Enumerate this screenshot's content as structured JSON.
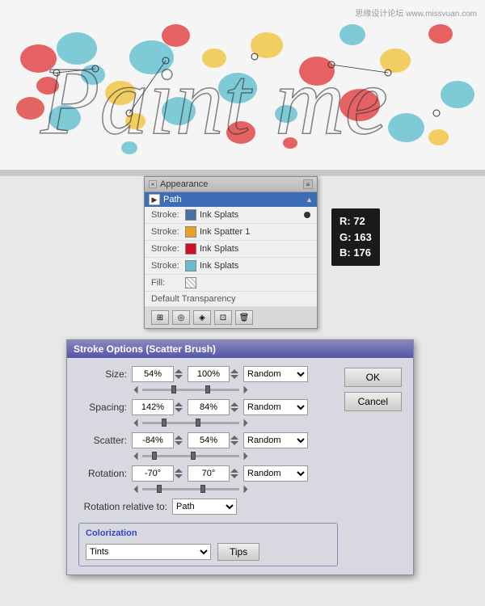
{
  "watermark": "思缘设计论坛 www.missvuan.com",
  "appearance_panel": {
    "title": "Appearance",
    "close_x": "×",
    "path_label": "Path",
    "rows": [
      {
        "label": "Stroke:",
        "color": "#4a6fa0",
        "name": "Ink Splats",
        "has_slider": true
      },
      {
        "label": "Stroke:",
        "color": "#e8a020",
        "name": "Ink Spatter 1",
        "has_slider": false
      },
      {
        "label": "Stroke:",
        "color": "#cc1122",
        "name": "Ink Splats",
        "has_slider": false
      },
      {
        "label": "Stroke:",
        "color": "#66bbcc",
        "name": "Ink Splats",
        "has_slider": false
      },
      {
        "label": "Fill:",
        "color": "transparent",
        "name": "",
        "has_slider": false,
        "is_fill": true
      }
    ],
    "transparency_label": "Default Transparency",
    "toolbar_buttons": [
      "link",
      "delete",
      "new",
      "trash"
    ]
  },
  "color_tooltip": {
    "r": "R: 72",
    "g": "G: 163",
    "b": "B: 176"
  },
  "stroke_options": {
    "title": "Stroke Options (Scatter Brush)",
    "size_label": "Size:",
    "size_min": "54%",
    "size_max": "100%",
    "size_dropdown": "Random",
    "spacing_label": "Spacing:",
    "spacing_min": "142%",
    "spacing_max": "84%",
    "spacing_dropdown": "Random",
    "scatter_label": "Scatter:",
    "scatter_min": "-84%",
    "scatter_max": "54%",
    "scatter_dropdown": "Random",
    "rotation_label": "Rotation:",
    "rotation_min": "-70°",
    "rotation_max": "70°",
    "rotation_dropdown": "Random",
    "rotation_relative_label": "Rotation relative to:",
    "rotation_relative_value": "Path",
    "colorization_title": "Colorization",
    "colorization_value": "Tints",
    "tips_label": "Tips",
    "ok_label": "OK",
    "cancel_label": "Cancel"
  }
}
